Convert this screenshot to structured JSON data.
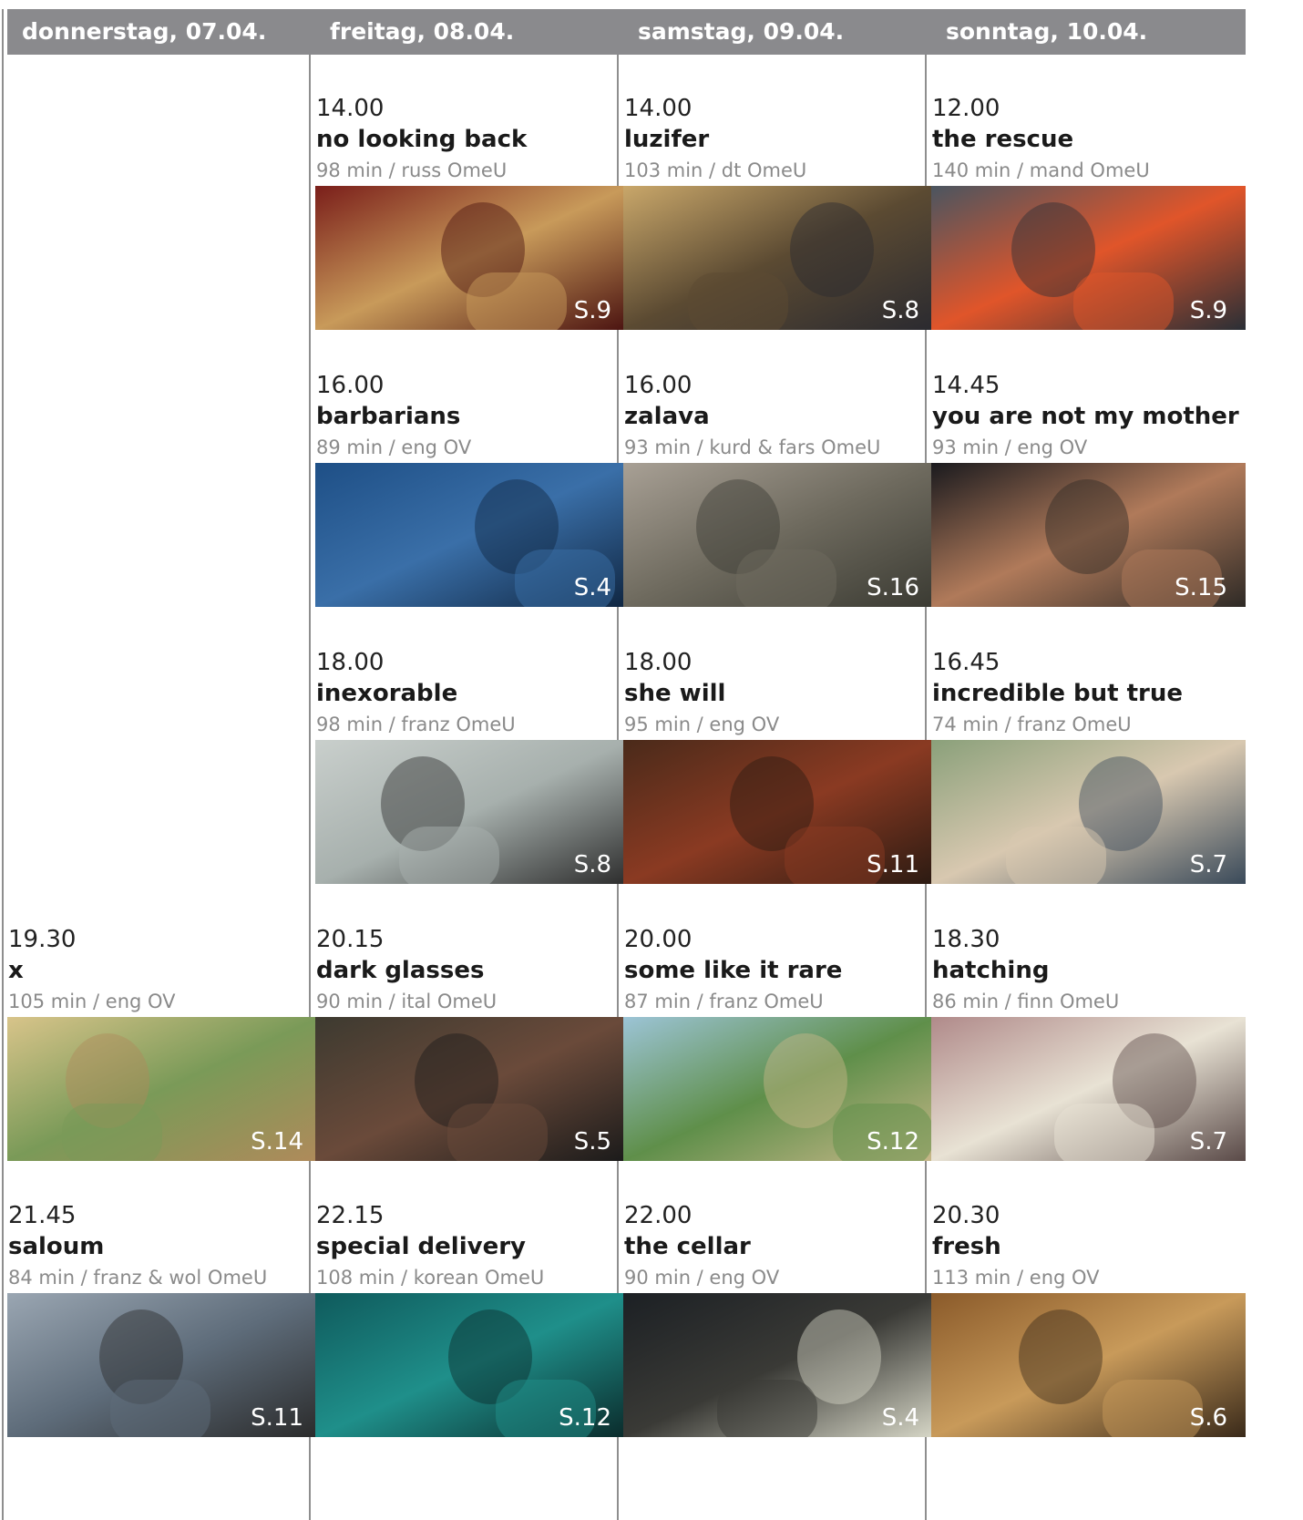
{
  "days": [
    {
      "header": "donnerstag, 07.04.",
      "films": [
        {
          "slot": 3,
          "time": "19.30",
          "title": "x",
          "meta": "105 min / eng OV",
          "page": "S.14",
          "still": {
            "colors": [
              "#d8c48a",
              "#7a9a58",
              "#b08a5a"
            ]
          }
        },
        {
          "slot": 4,
          "time": "21.45",
          "title": "saloum",
          "meta": "84 min / franz & wol OmeU",
          "page": "S.11",
          "still": {
            "colors": [
              "#9aa6b2",
              "#5e6c7a",
              "#2a2a2a"
            ]
          }
        }
      ]
    },
    {
      "header": "freitag, 08.04.",
      "films": [
        {
          "slot": 0,
          "time": "14.00",
          "title": "no looking back",
          "meta": "98 min / russ OmeU",
          "page": "S.9",
          "still": {
            "colors": [
              "#7a1e1a",
              "#c89a5a",
              "#4a1210"
            ]
          }
        },
        {
          "slot": 1,
          "time": "16.00",
          "title": "barbarians",
          "meta": "89 min / eng OV",
          "page": "S.4",
          "still": {
            "colors": [
              "#1e4f86",
              "#3a6fa8",
              "#0f2540"
            ]
          }
        },
        {
          "slot": 2,
          "time": "18.00",
          "title": "inexorable",
          "meta": "98 min / franz OmeU",
          "page": "S.8",
          "still": {
            "colors": [
              "#c9cfcc",
              "#a7b0ad",
              "#2c2c2c"
            ]
          }
        },
        {
          "slot": 3,
          "time": "20.15",
          "title": "dark glasses",
          "meta": "90 min / ital OmeU",
          "page": "S.5",
          "still": {
            "colors": [
              "#3d3a30",
              "#6a4a3a",
              "#1a1a1a"
            ]
          }
        },
        {
          "slot": 4,
          "time": "22.15",
          "title": "special delivery",
          "meta": "108 min / korean OmeU",
          "page": "S.12",
          "still": {
            "colors": [
              "#0f5a5c",
              "#1f8f8a",
              "#0a2a2a"
            ]
          }
        }
      ]
    },
    {
      "header": "samstag, 09.04.",
      "films": [
        {
          "slot": 0,
          "time": "14.00",
          "title": "luzifer",
          "meta": "103 min / dt OmeU",
          "page": "S.8",
          "still": {
            "colors": [
              "#c9a76a",
              "#5b4a32",
              "#2a2a30"
            ]
          }
        },
        {
          "slot": 1,
          "time": "16.00",
          "title": "zalava",
          "meta": "93 min / kurd & fars OmeU",
          "page": "S.16",
          "still": {
            "colors": [
              "#a8a095",
              "#6e6a5e",
              "#3a3a32"
            ]
          }
        },
        {
          "slot": 2,
          "time": "18.00",
          "title": "she will",
          "meta": "95 min / eng OV",
          "page": "S.11",
          "still": {
            "colors": [
              "#4a2a1a",
              "#8a3a22",
              "#2a1a12"
            ]
          }
        },
        {
          "slot": 3,
          "time": "20.00",
          "title": "some like it rare",
          "meta": "87 min / franz OmeU",
          "page": "S.12",
          "still": {
            "colors": [
              "#9cc4d6",
              "#5f8f4a",
              "#c9b88a"
            ]
          }
        },
        {
          "slot": 4,
          "time": "22.00",
          "title": "the cellar",
          "meta": "90 min / eng OV",
          "page": "S.4",
          "still": {
            "colors": [
              "#1c2024",
              "#3a3a36",
              "#d8d8c8"
            ]
          }
        }
      ]
    },
    {
      "header": "sonntag, 10.04.",
      "films": [
        {
          "slot": 0,
          "time": "12.00",
          "title": "the rescue",
          "meta": "140 min / mand OmeU",
          "page": "S.9",
          "still": {
            "colors": [
              "#4a5560",
              "#e0552a",
              "#2a2f36"
            ]
          }
        },
        {
          "slot": 1,
          "time": "14.45",
          "title": "you are not my mother",
          "meta": "93 min / eng OV",
          "page": "S.15",
          "still": {
            "colors": [
              "#1a1a1e",
              "#b07a5a",
              "#2e2a26"
            ]
          }
        },
        {
          "slot": 2,
          "time": "16.45",
          "title": "incredible but true",
          "meta": "74 min / franz OmeU",
          "page": "S.7",
          "still": {
            "colors": [
              "#8aa07a",
              "#d8c8b0",
              "#3a4a5a"
            ]
          }
        },
        {
          "slot": 3,
          "time": "18.30",
          "title": "hatching",
          "meta": "86 min / finn OmeU",
          "page": "S.7",
          "still": {
            "colors": [
              "#b08a8a",
              "#e8e2d4",
              "#5a4a48"
            ]
          }
        },
        {
          "slot": 4,
          "time": "20.30",
          "title": "fresh",
          "meta": "113 min / eng OV",
          "page": "S.6",
          "still": {
            "colors": [
              "#8a5a2a",
              "#c89a5a",
              "#3a2a1a"
            ]
          }
        }
      ]
    }
  ]
}
